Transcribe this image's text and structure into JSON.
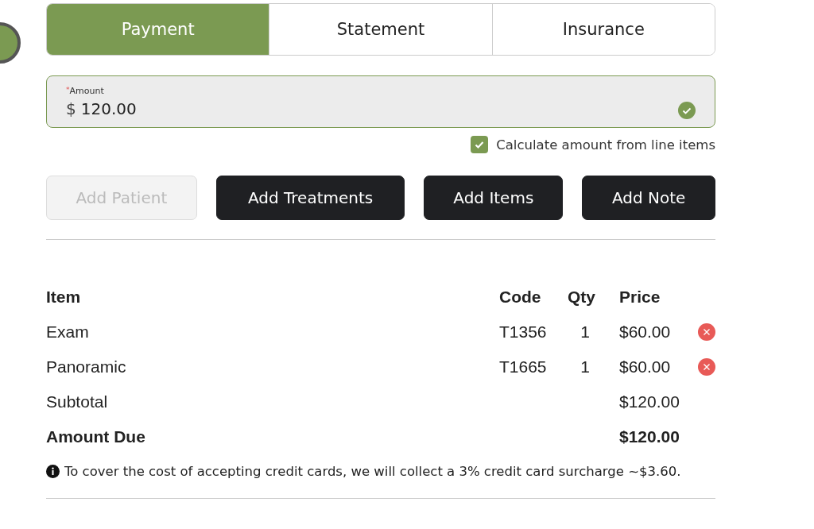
{
  "tabs": [
    {
      "label": "Payment",
      "selected": true
    },
    {
      "label": "Statement",
      "selected": false
    },
    {
      "label": "Insurance",
      "selected": false
    }
  ],
  "amount_field": {
    "label": "Amount",
    "required_mark": "*",
    "currency": "$",
    "value": "120.00",
    "valid": true
  },
  "calculate_checkbox": {
    "label": "Calculate amount from line items",
    "checked": true
  },
  "buttons": [
    {
      "label": "Add Patient",
      "disabled": true
    },
    {
      "label": "Add Treatments",
      "disabled": false
    },
    {
      "label": "Add Items",
      "disabled": false
    },
    {
      "label": "Add Note",
      "disabled": false
    }
  ],
  "table": {
    "columns": [
      "Item",
      "Code",
      "Qty",
      "Price"
    ],
    "rows": [
      {
        "kind": "item",
        "item": "Exam",
        "code": "T1356",
        "qty": "1",
        "price": "$60.00"
      },
      {
        "kind": "item",
        "item": "Panoramic",
        "code": "T1665",
        "qty": "1",
        "price": "$60.00"
      },
      {
        "kind": "subtotal",
        "item": "Subtotal",
        "price": "$120.00"
      },
      {
        "kind": "total",
        "item": "Amount Due",
        "price": "$120.00"
      }
    ]
  },
  "surcharge_note": "To cover the cost of accepting credit cards, we will collect a 3% credit card surcharge ~$3.60."
}
